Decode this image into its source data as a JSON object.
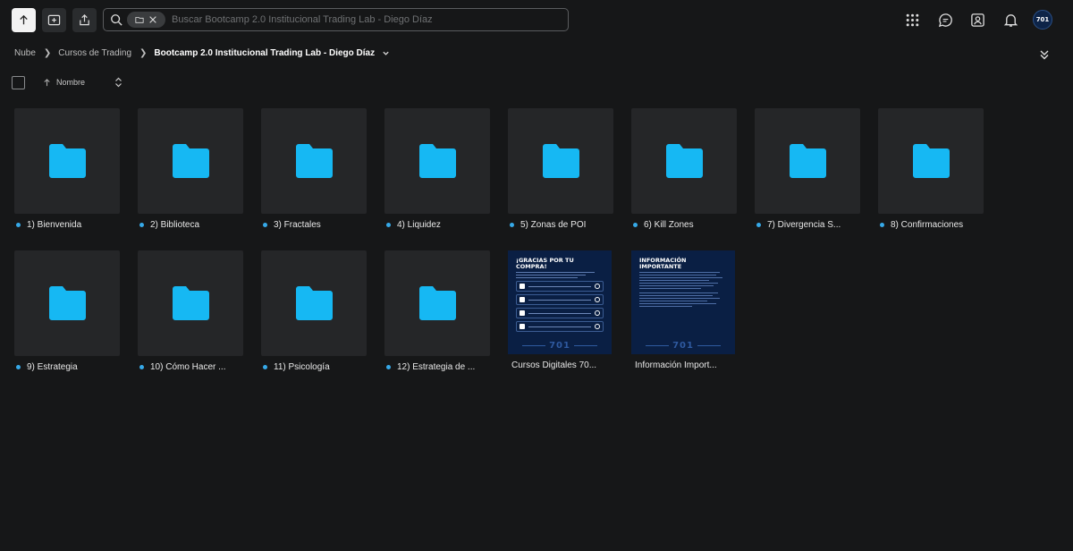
{
  "toolbar": {
    "upload_icon": "upload-arrow-icon",
    "new_folder_icon": "new-folder-icon",
    "share_icon": "share-icon"
  },
  "search": {
    "placeholder": "Buscar Bootcamp 2.0 Institucional Trading Lab - Diego Díaz",
    "filter_icon": "folder-filter-icon"
  },
  "header_right": {
    "icons": [
      "apps-grid-icon",
      "chat-icon",
      "contacts-icon",
      "bell-icon"
    ],
    "avatar_text": "701"
  },
  "breadcrumb": {
    "items": [
      "Nube",
      "Cursos de Trading"
    ],
    "current": "Bootcamp 2.0 Institucional Trading Lab - Diego Díaz"
  },
  "sort": {
    "label": "Nombre"
  },
  "colors": {
    "folder": "#16b8f3",
    "dot": "#36a9e8",
    "background": "#161718",
    "tile": "#252628"
  },
  "items": [
    {
      "name": "1) Bienvenida",
      "type": "folder"
    },
    {
      "name": "2) Biblioteca",
      "type": "folder"
    },
    {
      "name": "3) Fractales",
      "type": "folder"
    },
    {
      "name": "4) Liquidez",
      "type": "folder"
    },
    {
      "name": "5) Zonas de POI",
      "type": "folder"
    },
    {
      "name": "6) Kill Zones",
      "type": "folder"
    },
    {
      "name": "7) Divergencia S...",
      "type": "folder"
    },
    {
      "name": "8) Confirmaciones",
      "type": "folder"
    },
    {
      "name": "9) Estrategia",
      "type": "folder"
    },
    {
      "name": "10) Cómo Hacer ...",
      "type": "folder"
    },
    {
      "name": "11) Psicología",
      "type": "folder"
    },
    {
      "name": "12) Estrategia de ...",
      "type": "folder"
    },
    {
      "name": "Cursos Digitales 70...",
      "type": "image",
      "heading": "¡GRACIAS POR TU COMPRA!",
      "rows": [
        "INSTAGRAM",
        "TELEGRAM",
        "EMAIL",
        "SITIO WEB"
      ],
      "brand": "701"
    },
    {
      "name": "Información Import...",
      "type": "image",
      "heading": "INFORMACIÓN IMPORTANTE",
      "brand": "701"
    }
  ]
}
